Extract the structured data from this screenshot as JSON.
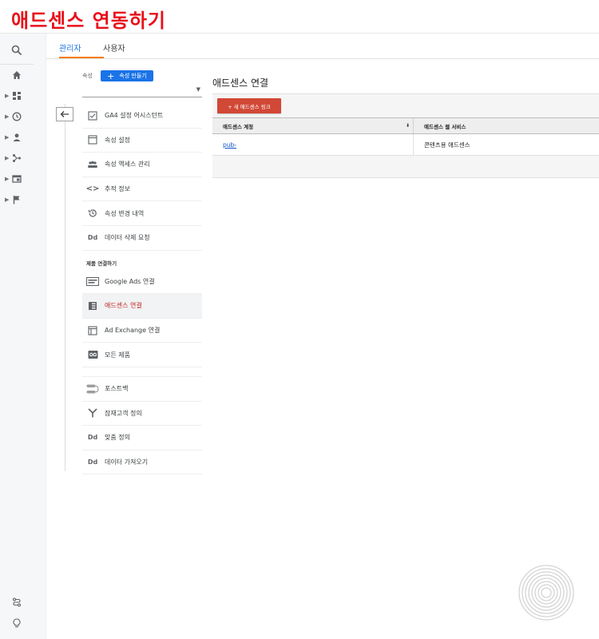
{
  "banner": {
    "title": "애드센스 연동하기"
  },
  "rail": {
    "icons": [
      "search-icon",
      "home-icon",
      "dashboard-icon",
      "clock-icon",
      "person-icon",
      "acquisition-icon",
      "display-icon",
      "flag-icon",
      "route-icon",
      "lightbulb-icon"
    ]
  },
  "tabs": [
    {
      "label": "관리자",
      "active": true
    },
    {
      "label": "사용자",
      "active": false
    }
  ],
  "property": {
    "label": "속성",
    "create_button": "속성 만들기"
  },
  "menu": {
    "items": [
      {
        "label": "GA4 설정 어시스턴트",
        "icon": "checkbox-icon"
      },
      {
        "label": "속성 설정",
        "icon": "window-icon"
      },
      {
        "label": "속성 액세스 관리",
        "icon": "people-icon"
      },
      {
        "label": "추적 정보",
        "icon": "code-icon"
      },
      {
        "label": "속성 변경 내역",
        "icon": "history-icon"
      },
      {
        "label": "데이터 삭제 요청",
        "icon": "dd-icon"
      }
    ],
    "section_label": "제품 연결하기",
    "link_items": [
      {
        "label": "Google Ads 연결",
        "icon": "ads-icon"
      },
      {
        "label": "애드센스 연결",
        "icon": "adsense-icon",
        "active": true
      },
      {
        "label": "Ad Exchange 연결",
        "icon": "adexchange-icon"
      },
      {
        "label": "모든 제품",
        "icon": "all-products-icon"
      }
    ],
    "other_items": [
      {
        "label": "포스트백",
        "icon": "postback-icon"
      },
      {
        "label": "잠재고객 정의",
        "icon": "audience-icon"
      },
      {
        "label": "맞춤 정의",
        "icon": "dd-icon"
      },
      {
        "label": "데이터 가져오기",
        "icon": "dd-icon"
      }
    ]
  },
  "content": {
    "title": "애드센스 연결",
    "new_link_button": "+ 새 애드센스 링크",
    "columns": [
      "애드센스 계정",
      "애드센스 웹 서비스"
    ],
    "rows": [
      {
        "account": "pub-",
        "service": "콘텐츠용 애드센스"
      }
    ]
  },
  "colors": {
    "accent": "#1a73e8",
    "banner_title": "#e8101a",
    "new_link_button": "#d14836",
    "tab_underline": "#f57c00"
  }
}
